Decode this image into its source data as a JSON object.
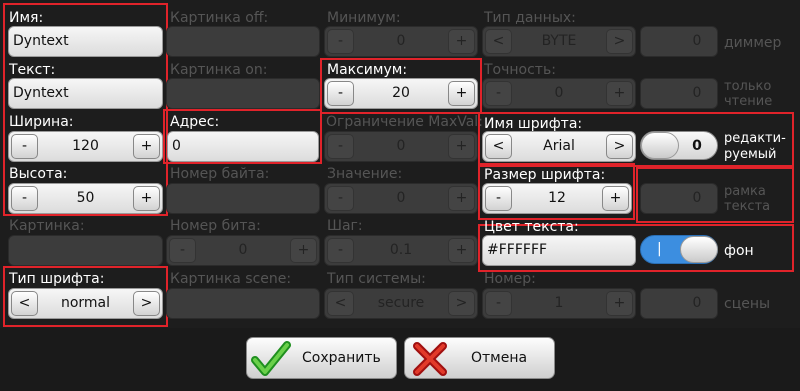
{
  "left": {
    "name": {
      "label": "Имя:",
      "value": "Dyntext"
    },
    "text": {
      "label": "Текст:",
      "value": "Dyntext"
    },
    "width": {
      "label": "Ширина:",
      "value": "120",
      "minus": "-",
      "plus": "+"
    },
    "height": {
      "label": "Высота:",
      "value": "50",
      "minus": "-",
      "plus": "+"
    },
    "picture": {
      "label": "Картинка:"
    },
    "font_type": {
      "label": "Тип шрифта:",
      "value": "normal",
      "prev": "<",
      "next": ">"
    }
  },
  "col2": {
    "picture_off": {
      "label": "Картинка off:"
    },
    "picture_on": {
      "label": "Картинка on:"
    },
    "address": {
      "label": "Адрес:",
      "value": "0"
    },
    "byte_number": {
      "label": "Номер байта:"
    },
    "bit_number": {
      "label": "Номер бита:",
      "value": "0",
      "minus": "-",
      "plus": "+"
    },
    "picture_scene": {
      "label": "Картинка scene:"
    }
  },
  "col3": {
    "minimum": {
      "label": "Минимум:",
      "value": "0",
      "minus": "-",
      "plus": "+"
    },
    "maximum": {
      "label": "Максимум:",
      "value": "20",
      "minus": "-",
      "plus": "+"
    },
    "limit_maxval": {
      "label": "Ограничение MaxVal:",
      "value": "0",
      "minus": "-",
      "plus": "+"
    },
    "value": {
      "label": "Значение:",
      "value": "0",
      "minus": "-",
      "plus": "+"
    },
    "step": {
      "label": "Шаг:",
      "value": "0.1",
      "minus": "-",
      "plus": "+"
    },
    "system_type": {
      "label": "Тип системы:",
      "value": "secure",
      "prev": "<",
      "next": ">"
    }
  },
  "col4": {
    "data_type": {
      "label": "Тип данных:",
      "value": "BYTE",
      "prev": "<",
      "next": ">"
    },
    "dimmer": {
      "value": "0",
      "caption": "диммер"
    },
    "precision": {
      "label": "Точность:",
      "value": "0",
      "minus": "-",
      "plus": "+"
    },
    "read_only": {
      "value": "0",
      "caption_1": "только",
      "caption_2": "чтение"
    },
    "font_name": {
      "label": "Имя шрифта:",
      "value": "Arial",
      "prev": "<",
      "next": ">"
    },
    "editable": {
      "value": "0",
      "caption_1": "редакти-",
      "caption_2": "руемый"
    },
    "font_size": {
      "label": "Размер шрифта:",
      "value": "12",
      "minus": "-",
      "plus": "+"
    },
    "text_frame": {
      "value": "0",
      "caption_1": "рамка",
      "caption_2": "текста"
    },
    "text_color": {
      "label": "Цвет текста:",
      "value": "#FFFFFF"
    },
    "background": {
      "on_mark": "|",
      "caption": "фон"
    },
    "number": {
      "label": "Номер:",
      "value": "1",
      "minus": "-",
      "plus": "+"
    },
    "scenes": {
      "value": "0",
      "caption": "сцены"
    }
  },
  "actions": {
    "save": "Сохранить",
    "cancel": "Отмена"
  },
  "colors": {
    "highlight": "#e0232a",
    "toggle_on": "#3c8ee0"
  }
}
